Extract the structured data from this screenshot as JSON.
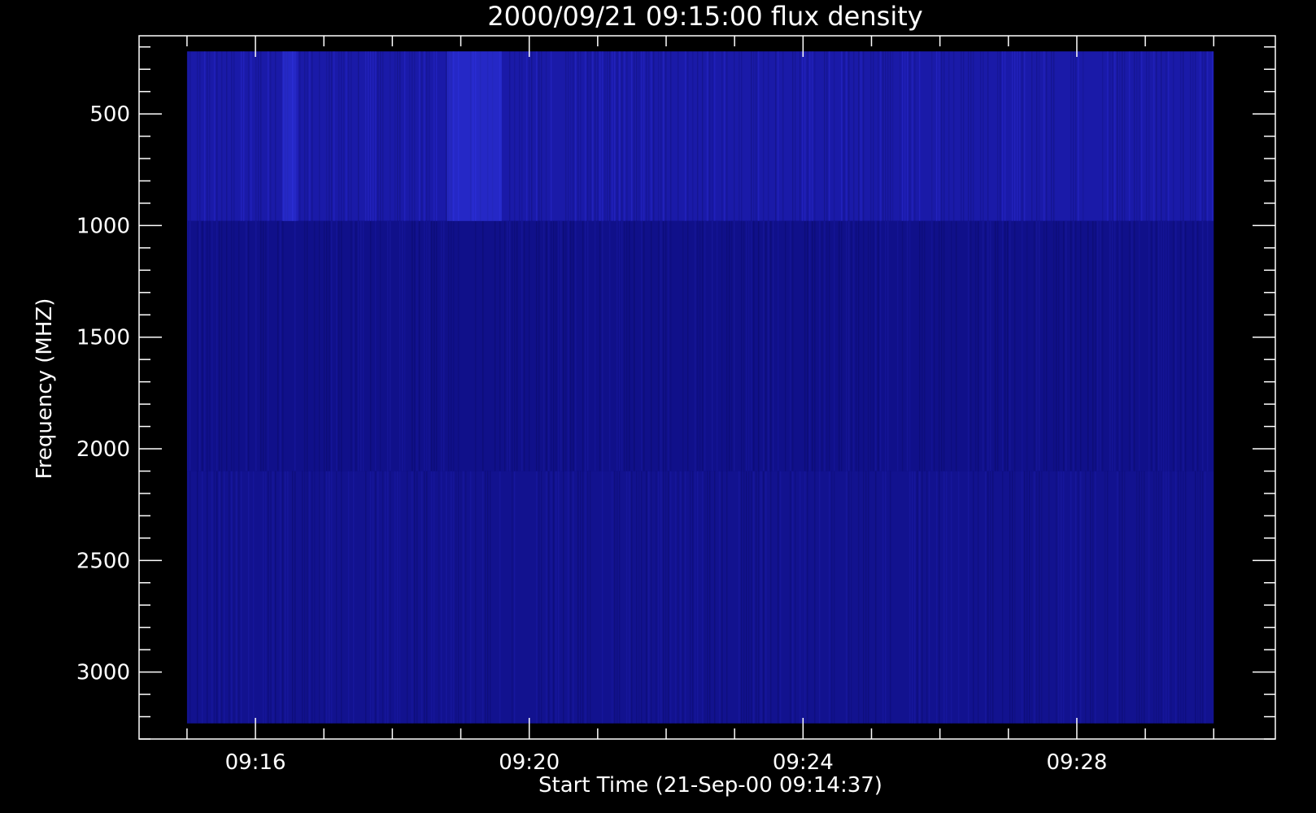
{
  "chart_data": {
    "type": "heatmap",
    "title": "2000/09/21 09:15:00 flux density",
    "xlabel": "Start Time (21-Sep-00 09:14:37)",
    "ylabel": "Frequency (MHZ)",
    "x_tick_labels": [
      "09:16",
      "09:20",
      "09:24",
      "09:28"
    ],
    "x_major_ticks_min": [
      16,
      20,
      24,
      28
    ],
    "x_minor_step_min": 1,
    "xlim_min": [
      14.3,
      30.9
    ],
    "y_tick_labels": [
      "500",
      "1000",
      "1500",
      "2000",
      "2500",
      "3000"
    ],
    "y_major_ticks": [
      500,
      1000,
      1500,
      2000,
      2500,
      3000
    ],
    "y_minor_step": 100,
    "ylim": [
      3300,
      150
    ],
    "y_inverted": true,
    "data_extent": {
      "t_start_min": 15.0,
      "t_end_min": 30.0,
      "f_low": 220,
      "f_high": 3230
    },
    "bands": [
      {
        "f_low": 220,
        "f_high": 980,
        "color": "#1a1aa8"
      },
      {
        "f_low": 980,
        "f_high": 2100,
        "color": "#10108a"
      },
      {
        "f_low": 2100,
        "f_high": 3230,
        "color": "#12128f"
      }
    ],
    "bright_intervals_min": [
      [
        16.4,
        16.6
      ],
      [
        18.8,
        19.6
      ]
    ],
    "colors": {
      "background": "#000000",
      "axes": "#ffffff"
    }
  }
}
